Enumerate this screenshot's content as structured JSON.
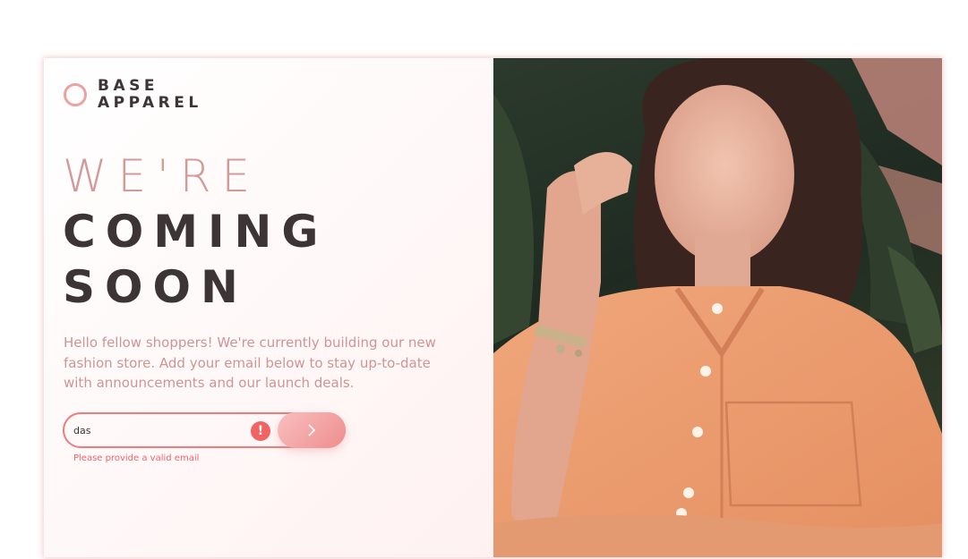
{
  "brand": {
    "line1": "BASE",
    "line2": "APPAREL"
  },
  "headline": {
    "light": "WE'RE",
    "dark1": "COMING",
    "dark2": "SOON"
  },
  "description": "Hello fellow shoppers! We're currently building our new fashion store. Add your email below to stay up-to-date with announcements and our launch deals.",
  "form": {
    "email_value": "das",
    "error_icon_glyph": "!",
    "error_message": "Please provide a valid email",
    "submit_icon": "chevron-right-icon"
  },
  "hero_image": {
    "subject": "portrait-photo",
    "alt": "Woman in an orange shirt"
  },
  "colors": {
    "accent": "#eea1a1",
    "text_dark": "#3d3435",
    "text_muted": "#cf9494",
    "error": "#f16464"
  }
}
